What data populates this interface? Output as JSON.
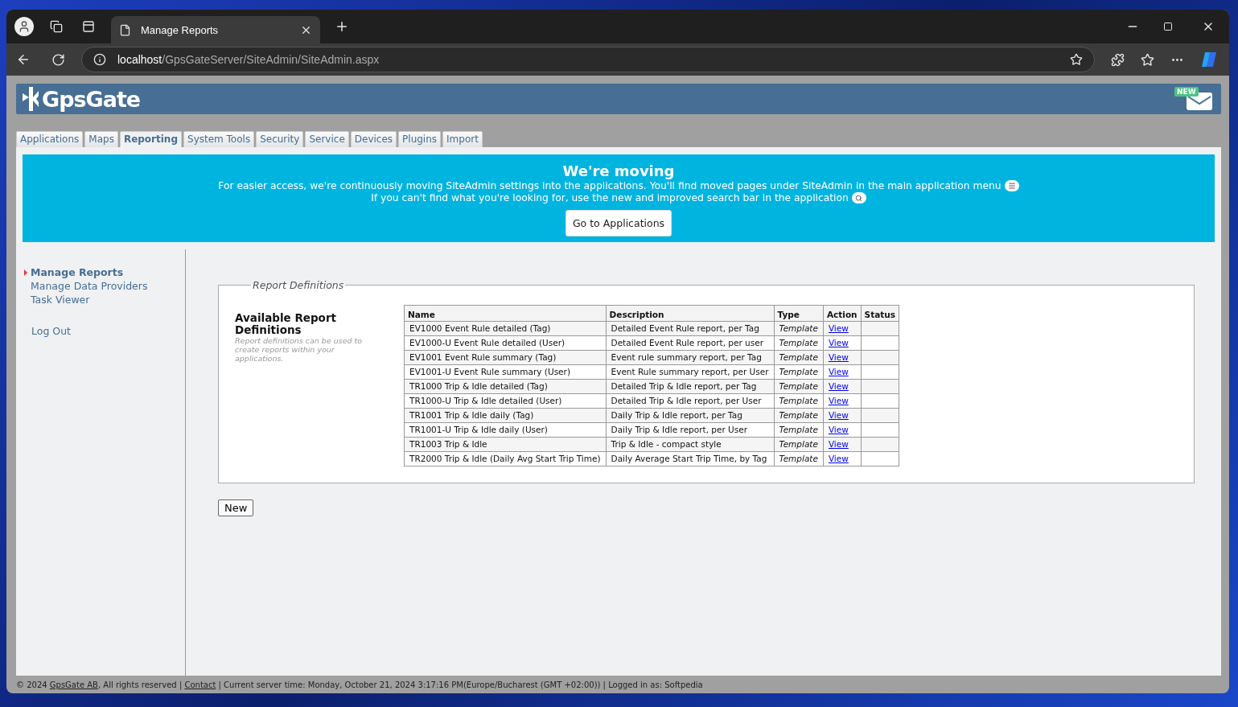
{
  "browser": {
    "tab_title": "Manage Reports",
    "url_host": "localhost",
    "url_path": "/GpsGateServer/SiteAdmin/SiteAdmin.aspx"
  },
  "header": {
    "brand": "GpsGate",
    "mail_badge": "NEW"
  },
  "tabs": [
    {
      "label": "Applications",
      "selected": false
    },
    {
      "label": "Maps",
      "selected": false
    },
    {
      "label": "Reporting",
      "selected": true
    },
    {
      "label": "System Tools",
      "selected": false
    },
    {
      "label": "Security",
      "selected": false
    },
    {
      "label": "Service",
      "selected": false
    },
    {
      "label": "Devices",
      "selected": false
    },
    {
      "label": "Plugins",
      "selected": false
    },
    {
      "label": "Import",
      "selected": false
    }
  ],
  "banner": {
    "title": "We're moving",
    "line_1": "For easier access, we're continuously moving SiteAdmin settings into the applications. You'll find moved pages under SiteAdmin in the main application menu",
    "line_2": "If you can't find what you're looking for, use the new and improved search bar in the application",
    "button": "Go to Applications"
  },
  "sidebar": {
    "items": [
      {
        "label": "Manage Reports",
        "selected": true
      },
      {
        "label": "Manage Data Providers",
        "selected": false
      },
      {
        "label": "Task Viewer",
        "selected": false
      }
    ],
    "logout": "Log Out"
  },
  "section": {
    "legend": "Report Definitions",
    "heading": "Available Report Definitions",
    "description": "Report definitions can be used to create reports within your applications."
  },
  "table": {
    "columns": [
      "Name",
      "Description",
      "Type",
      "Action",
      "Status"
    ],
    "rows": [
      {
        "name": "EV1000 Event Rule detailed (Tag)",
        "description": "Detailed Event Rule report, per Tag",
        "type": "Template",
        "action": "View"
      },
      {
        "name": "EV1000-U Event Rule detailed (User)",
        "description": "Detailed Event Rule report, per user",
        "type": "Template",
        "action": "View"
      },
      {
        "name": "EV1001 Event Rule summary (Tag)",
        "description": "Event rule summary report, per Tag",
        "type": "Template",
        "action": "View"
      },
      {
        "name": "EV1001-U Event Rule summary (User)",
        "description": "Event Rule summary report, per User",
        "type": "Template",
        "action": "View"
      },
      {
        "name": "TR1000 Trip & Idle detailed (Tag)",
        "description": "Detailed Trip & Idle report, per Tag",
        "type": "Template",
        "action": "View"
      },
      {
        "name": "TR1000-U Trip & Idle detailed (User)",
        "description": "Detailed Trip & Idle report, per User",
        "type": "Template",
        "action": "View"
      },
      {
        "name": "TR1001 Trip & Idle daily (Tag)",
        "description": "Daily Trip & Idle report, per Tag",
        "type": "Template",
        "action": "View"
      },
      {
        "name": "TR1001-U Trip & Idle daily (User)",
        "description": "Daily Trip & Idle report, per User",
        "type": "Template",
        "action": "View"
      },
      {
        "name": "TR1003 Trip & Idle",
        "description": "Trip & Idle - compact style",
        "type": "Template",
        "action": "View"
      },
      {
        "name": "TR2000 Trip & Idle (Daily Avg Start Trip Time)",
        "description": "Daily Average Start Trip Time, by Tag",
        "type": "Template",
        "action": "View"
      }
    ]
  },
  "new_button": "New",
  "footer": [
    {
      "kind": "text",
      "text": "© 2024 "
    },
    {
      "kind": "link",
      "text": "GpsGate AB"
    },
    {
      "kind": "text",
      "text": ", All rights reserved | "
    },
    {
      "kind": "link",
      "text": "Contact"
    },
    {
      "kind": "text",
      "text": " | Current server time: Monday, October 21, 2024 3:17:16 PM(Europe/Bucharest (GMT +02:00)) | Logged in as: Softpedia"
    }
  ]
}
